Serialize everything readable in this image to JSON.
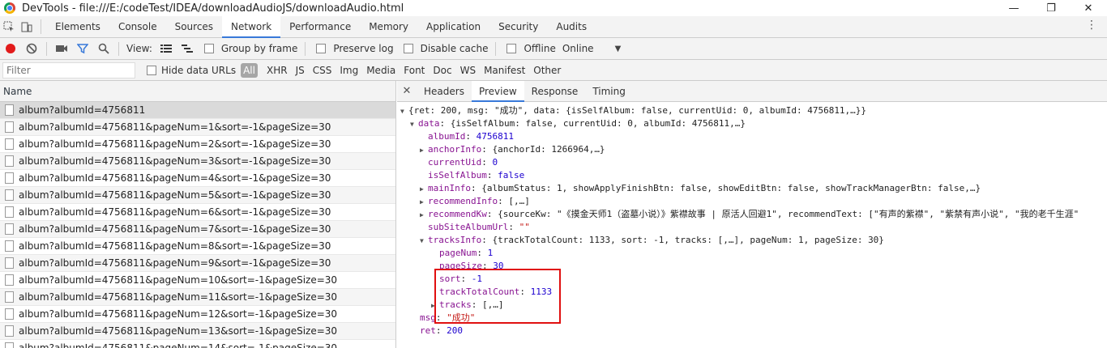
{
  "window": {
    "title": "DevTools - file:///E:/codeTest/IDEA/downloadAudioJS/downloadAudio.html",
    "minimize_glyph": "—",
    "restore_glyph": "❐",
    "close_glyph": "✕"
  },
  "tabs": [
    "Elements",
    "Console",
    "Sources",
    "Network",
    "Performance",
    "Memory",
    "Application",
    "Security",
    "Audits"
  ],
  "active_tab": "Network",
  "toolbar": {
    "view_label": "View:",
    "group_by_frame": "Group by frame",
    "preserve_log": "Preserve log",
    "disable_cache": "Disable cache",
    "offline": "Offline",
    "throttle": "Online"
  },
  "filter": {
    "placeholder": "Filter",
    "hide_data_urls": "Hide data URLs",
    "types": [
      "All",
      "XHR",
      "JS",
      "CSS",
      "Img",
      "Media",
      "Font",
      "Doc",
      "WS",
      "Manifest",
      "Other"
    ]
  },
  "requests": {
    "header": "Name",
    "items": [
      "album?albumId=4756811",
      "album?albumId=4756811&pageNum=1&sort=-1&pageSize=30",
      "album?albumId=4756811&pageNum=2&sort=-1&pageSize=30",
      "album?albumId=4756811&pageNum=3&sort=-1&pageSize=30",
      "album?albumId=4756811&pageNum=4&sort=-1&pageSize=30",
      "album?albumId=4756811&pageNum=5&sort=-1&pageSize=30",
      "album?albumId=4756811&pageNum=6&sort=-1&pageSize=30",
      "album?albumId=4756811&pageNum=7&sort=-1&pageSize=30",
      "album?albumId=4756811&pageNum=8&sort=-1&pageSize=30",
      "album?albumId=4756811&pageNum=9&sort=-1&pageSize=30",
      "album?albumId=4756811&pageNum=10&sort=-1&pageSize=30",
      "album?albumId=4756811&pageNum=11&sort=-1&pageSize=30",
      "album?albumId=4756811&pageNum=12&sort=-1&pageSize=30",
      "album?albumId=4756811&pageNum=13&sort=-1&pageSize=30",
      "album?albumId=4756811&pageNum=14&sort=-1&pageSize=30"
    ]
  },
  "detail_tabs": [
    "Headers",
    "Preview",
    "Response",
    "Timing"
  ],
  "active_detail_tab": "Preview",
  "preview": {
    "root": "{ret: 200, msg: \"成功\", data: {isSelfAlbum: false, currentUid: 0, albumId: 4756811,…}}",
    "data_summary": "{isSelfAlbum: false, currentUid: 0, albumId: 4756811,…}",
    "albumId": "4756811",
    "anchorInfo": "{anchorId: 1266964,…}",
    "currentUid": "0",
    "isSelfAlbum": "false",
    "mainInfo": "{albumStatus: 1, showApplyFinishBtn: false, showEditBtn: false, showTrackManagerBtn: false,…}",
    "recommendInfo": "[,…]",
    "recommendKw": "{sourceKw: \"《摸金天师1（盗墓小说）》紫襟故事 | 原活人回避1\", recommendText: [\"有声的紫襟\", \"紫禁有声小说\", \"我的老千生涯\"",
    "subSiteAlbumUrl": "\"\"",
    "tracksInfo": "{trackTotalCount: 1133, sort: -1, tracks: [,…], pageNum: 1, pageSize: 30}",
    "pageNum": "1",
    "pageSize": "30",
    "sort": "-1",
    "trackTotalCount": "1133",
    "tracks": "[,…]",
    "msg": "\"成功\"",
    "ret": "200"
  }
}
